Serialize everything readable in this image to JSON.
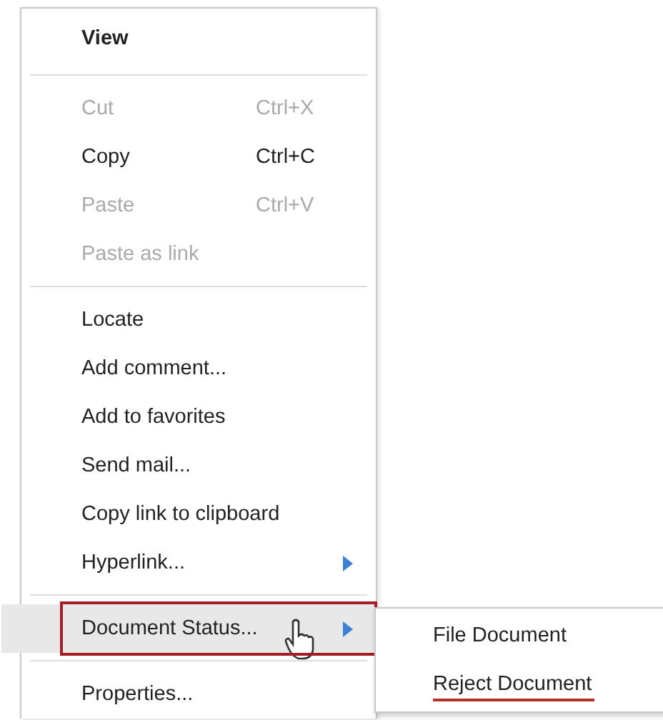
{
  "menu": {
    "items": [
      {
        "kind": "header",
        "label": "View"
      },
      {
        "kind": "divider"
      },
      {
        "kind": "item",
        "label": "Cut",
        "shortcut": "Ctrl+X",
        "disabled": true,
        "has_submenu": false,
        "highlighted": false
      },
      {
        "kind": "item",
        "label": "Copy",
        "shortcut": "Ctrl+C",
        "disabled": false,
        "has_submenu": false,
        "highlighted": false
      },
      {
        "kind": "item",
        "label": "Paste",
        "shortcut": "Ctrl+V",
        "disabled": true,
        "has_submenu": false,
        "highlighted": false
      },
      {
        "kind": "item",
        "label": "Paste as link",
        "disabled": true,
        "has_submenu": false,
        "highlighted": false
      },
      {
        "kind": "divider"
      },
      {
        "kind": "item",
        "label": "Locate",
        "disabled": false,
        "has_submenu": false,
        "highlighted": false
      },
      {
        "kind": "item",
        "label": "Add comment...",
        "disabled": false,
        "has_submenu": false,
        "highlighted": false
      },
      {
        "kind": "item",
        "label": "Add to favorites",
        "disabled": false,
        "has_submenu": false,
        "highlighted": false
      },
      {
        "kind": "item",
        "label": "Send mail...",
        "disabled": false,
        "has_submenu": false,
        "highlighted": false
      },
      {
        "kind": "item",
        "label": "Copy link to clipboard",
        "disabled": false,
        "has_submenu": false,
        "highlighted": false
      },
      {
        "kind": "item",
        "label": "Hyperlink...",
        "disabled": false,
        "has_submenu": true,
        "highlighted": false
      },
      {
        "kind": "divider"
      },
      {
        "kind": "item",
        "label": "Document Status...",
        "disabled": false,
        "has_submenu": true,
        "highlighted": true,
        "submenu": [
          {
            "label": "File Document",
            "underlined": false
          },
          {
            "label": "Reject Document",
            "underlined": true
          }
        ]
      },
      {
        "kind": "divider"
      },
      {
        "kind": "item",
        "label": "Properties...",
        "disabled": false,
        "has_submenu": false,
        "highlighted": false
      }
    ]
  }
}
